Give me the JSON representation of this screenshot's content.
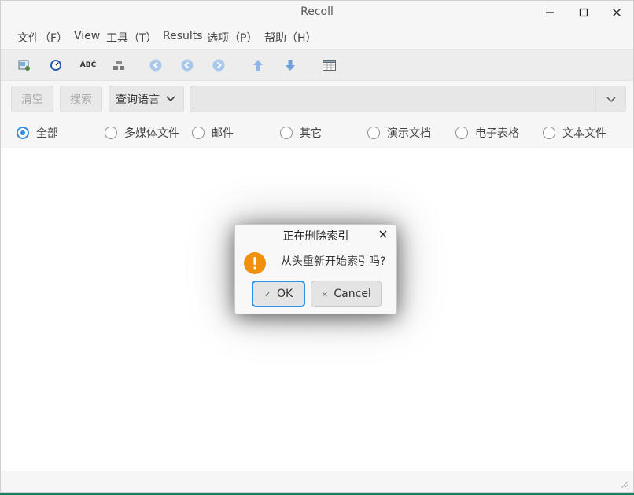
{
  "window": {
    "title": "Recoll"
  },
  "menu": [
    {
      "label": "文件（F）"
    },
    {
      "label": "View"
    },
    {
      "label": "工具（T）"
    },
    {
      "label": "Results"
    },
    {
      "label": "选项（P）"
    },
    {
      "label": "帮助（H）"
    }
  ],
  "toolbar": {
    "icons": [
      "index-config-icon",
      "speedometer-icon",
      "spell-abc-icon",
      "database-icon",
      "first-page-icon",
      "previous-page-icon",
      "next-page-icon",
      "sort-ascending-icon",
      "sort-descending-icon",
      "table-view-icon"
    ],
    "spell_text": "ÂBĈ"
  },
  "search": {
    "clear_label": "清空",
    "search_label": "搜索",
    "lang_label": "查询语言",
    "query_value": ""
  },
  "categories": [
    {
      "label": "全部",
      "checked": true
    },
    {
      "label": "多媒体文件",
      "checked": false
    },
    {
      "label": "邮件",
      "checked": false
    },
    {
      "label": "其它",
      "checked": false
    },
    {
      "label": "演示文档",
      "checked": false
    },
    {
      "label": "电子表格",
      "checked": false
    },
    {
      "label": "文本文件",
      "checked": false
    }
  ],
  "dialog": {
    "title": "正在删除索引",
    "message": "从头重新开始索引吗?",
    "ok_label": "OK",
    "cancel_label": "Cancel"
  },
  "colors": {
    "accent": "#2f8fe0",
    "warning": "#f0900e",
    "desktop": "#1e7d5e"
  }
}
